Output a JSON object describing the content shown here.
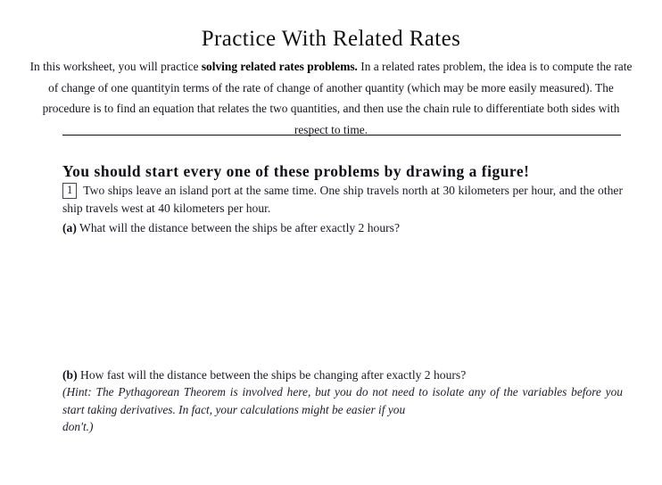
{
  "document": {
    "title": "Practice With Related Rates",
    "intro": {
      "before_bold": "In this worksheet, you will practice ",
      "bold_phrase": "solving related rates problems.",
      "after_bold": " In a related rates problem, the idea is to compute the rate of change of one quantityin terms of the rate of change of another quantity (which may be more easily measured). The procedure is to find an equation that relates the two quantities, and then use the chain rule to differentiate both sides with respect to time."
    },
    "section_heading": "You should start every one of these problems by drawing a figure!",
    "problem": {
      "number": "1",
      "statement": "Two ships leave an island port at the same time. One ship travels north at 30 kilometers per hour, and the other ship travels west at 40 kilometers per hour.",
      "parts": [
        {
          "label": "(a)",
          "text": " What will the distance between the ships be after exactly 2 hours?"
        },
        {
          "label": "(b)",
          "text": " How fast will the distance between the ships be changing after exactly 2 hours?"
        }
      ],
      "hint_main": "(Hint: The Pythagorean Theorem is involved here, but you do not need to isolate any of the variables before you start taking derivatives. In fact, your calculations might be easier if you",
      "hint_last_line": "don't.)"
    }
  },
  "colors": {
    "page_background": "#ffffff",
    "body_text": "#1a1a24",
    "title_text": "#111111",
    "rule": "#101010"
  }
}
